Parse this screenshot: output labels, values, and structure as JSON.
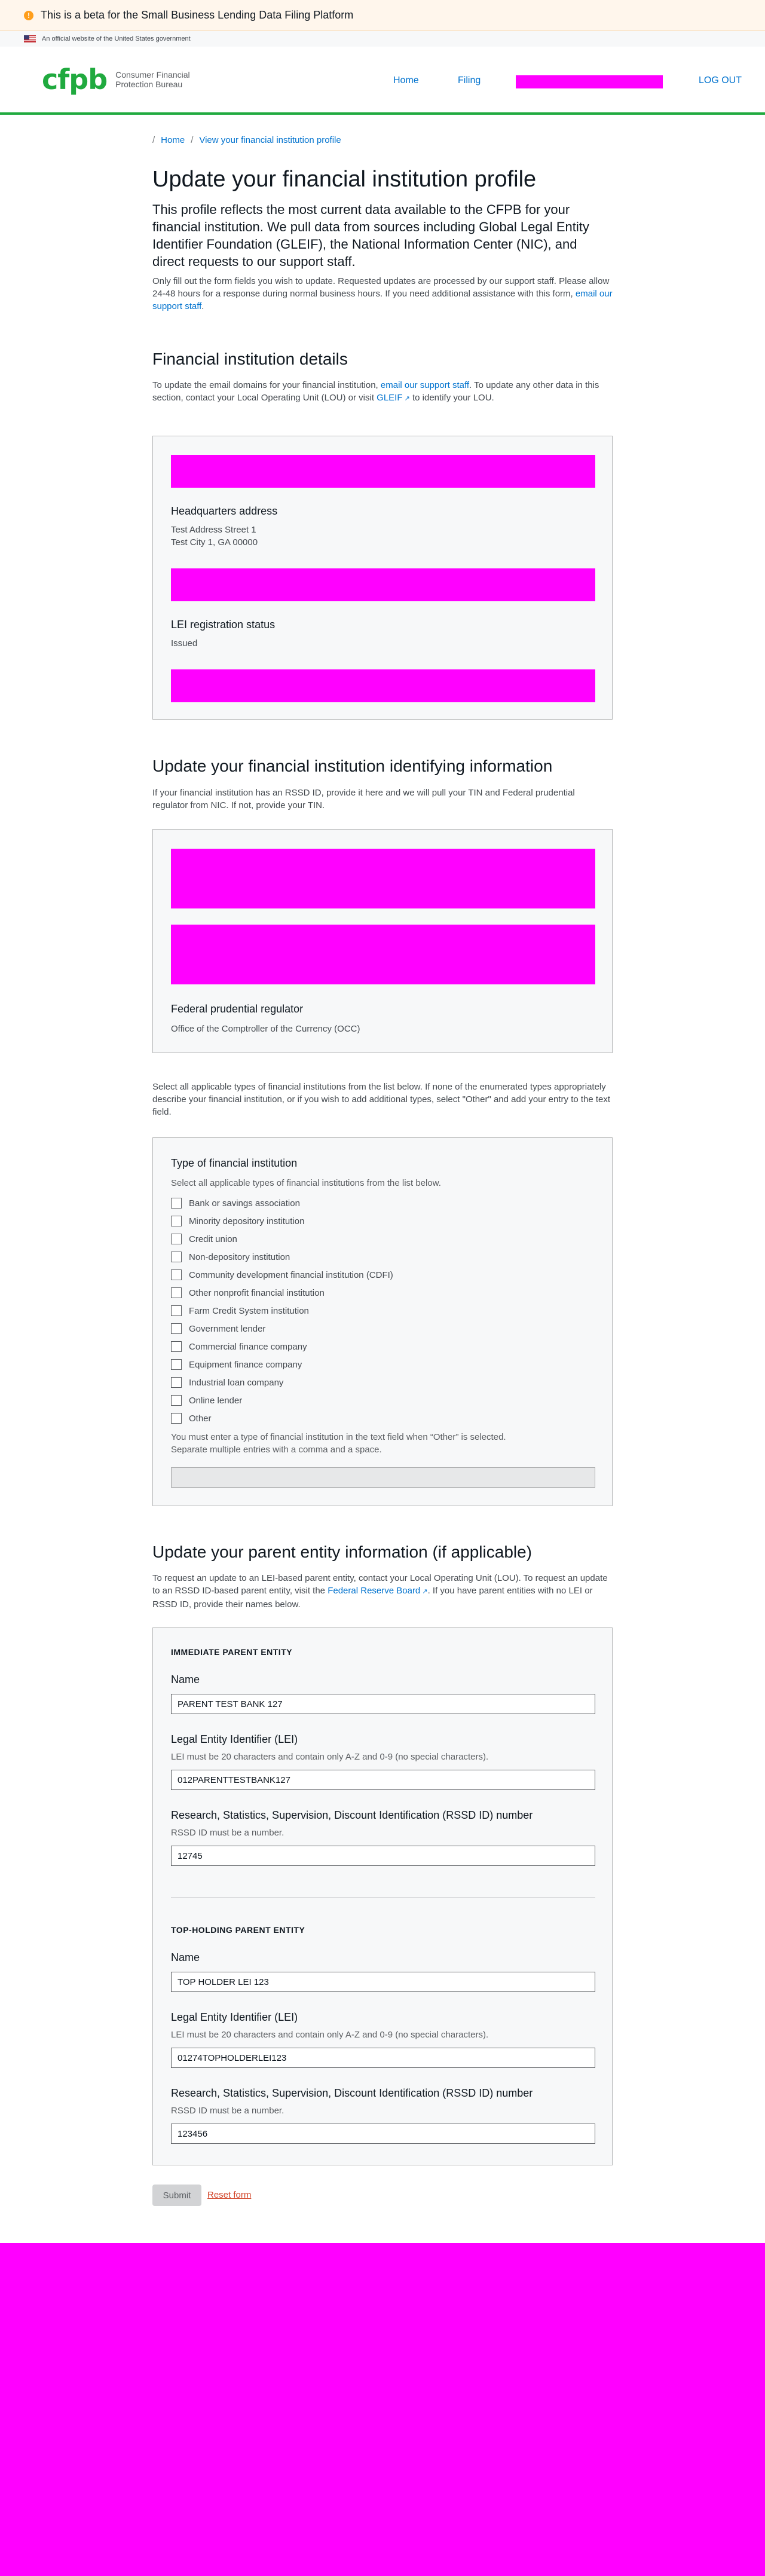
{
  "beta_banner": {
    "text": "This is a beta for the Small Business Lending Data Filing Platform"
  },
  "gov_banner": {
    "text": "An official website of the United States government"
  },
  "header": {
    "logo_mark": "cfpb",
    "logo_line1": "Consumer Financial",
    "logo_line2": "Protection Bureau",
    "nav": {
      "home": "Home",
      "filing": "Filing",
      "logout": "LOG OUT"
    }
  },
  "breadcrumb": {
    "home": "Home",
    "separator": "/",
    "profile": "View your financial institution profile"
  },
  "page": {
    "title": "Update your financial institution profile",
    "lead": "This profile reflects the most current data available to the CFPB for your financial institution. We pull data from sources including Global Legal Entity Identifier Foundation (GLEIF), the National Information Center (NIC), and direct requests to our support staff.",
    "intro_prefix": "Only fill out the form fields you wish to update. Requested updates are processed by our support staff. Please allow 24-48 hours for a response during normal business hours. If you need additional assistance with this form,",
    "intro_link": "email our support staff",
    "intro_suffix": "."
  },
  "fi_details": {
    "heading": "Financial institution details",
    "desc_prefix": "To update the email domains for your financial institution,",
    "desc_link": "email our support staff",
    "desc_middle": ". To update any other data in this section, contact your Local Operating Unit (LOU) or visit",
    "desc_link2": "GLEIF",
    "desc_suffix": "to identify your LOU.",
    "hq_label": "Headquarters address",
    "hq_line1": "Test Address Street 1",
    "hq_line2": "Test City 1, GA 00000",
    "lei_status_label": "LEI registration status",
    "lei_status_value": "Issued"
  },
  "identifying": {
    "heading": "Update your financial institution identifying information",
    "desc": "If your financial institution has an RSSD ID, provide it here and we will pull your TIN and Federal prudential regulator from NIC. If not, provide your TIN.",
    "regulator_label": "Federal prudential regulator",
    "regulator_value": "Office of the Comptroller of the Currency (OCC)"
  },
  "types": {
    "intro": "Select all applicable types of financial institutions from the list below. If none of the enumerated types appropriately describe your financial institution, or if you wish to add additional types, select \"Other\" and add your entry to the text field.",
    "label": "Type of financial institution",
    "help": "Select all applicable types of financial institutions from the list below.",
    "options": [
      "Bank or savings association",
      "Minority depository institution",
      "Credit union",
      "Non-depository institution",
      "Community development financial institution (CDFI)",
      "Other nonprofit financial institution",
      "Farm Credit System institution",
      "Government lender",
      "Commercial finance company",
      "Equipment finance company",
      "Industrial loan company",
      "Online lender",
      "Other"
    ],
    "other_help_line1": "You must enter a type of financial institution in the text field when “Other” is selected.",
    "other_help_line2": "Separate multiple entries with a comma and a space."
  },
  "parent": {
    "heading": "Update your parent entity information (if applicable)",
    "desc_prefix": "To request an update to an LEI-based parent entity, contact your Local Operating Unit (LOU). To request an update to an RSSD ID-based parent entity, visit the",
    "desc_link": "Federal Reserve Board",
    "desc_suffix": ". If you have parent entities with no LEI or RSSD ID, provide their names below.",
    "immediate": {
      "eyebrow": "IMMEDIATE PARENT ENTITY",
      "name_label": "Name",
      "name_value": "PARENT TEST BANK 127",
      "lei_label": "Legal Entity Identifier (LEI)",
      "lei_help": "LEI must be 20 characters and contain only A-Z and 0-9 (no special characters).",
      "lei_value": "012PARENTTESTBANK127",
      "rssd_label": "Research, Statistics, Supervision, Discount Identification (RSSD ID) number",
      "rssd_help": "RSSD ID must be a number.",
      "rssd_value": "12745"
    },
    "top": {
      "eyebrow": "TOP-HOLDING PARENT ENTITY",
      "name_label": "Name",
      "name_value": "TOP HOLDER LEI 123",
      "lei_label": "Legal Entity Identifier (LEI)",
      "lei_help": "LEI must be 20 characters and contain only A-Z and 0-9 (no special characters).",
      "lei_value": "01274TOPHOLDERLEI123",
      "rssd_label": "Research, Statistics, Supervision, Discount Identification (RSSD ID) number",
      "rssd_help": "RSSD ID must be a number.",
      "rssd_value": "123456"
    }
  },
  "actions": {
    "submit": "Submit",
    "reset": "Reset form"
  },
  "colors": {
    "redaction": "#ff00ff",
    "brand_green": "#20aa3f",
    "link": "#0072ce",
    "reset": "#d14124"
  }
}
